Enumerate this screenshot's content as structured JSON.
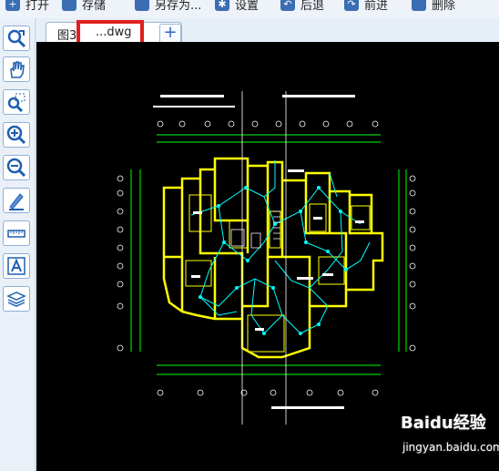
{
  "toolbar": {
    "open": "打开",
    "save": "存储",
    "save_as": "另存为...",
    "settings": "设置",
    "back": "后退",
    "forward": "前进",
    "delete": "删除"
  },
  "tabs": {
    "file_prefix": "图3",
    "file_suffix": "...dwg",
    "add": "+"
  },
  "watermark": {
    "brand": "Baidu经验",
    "url": "jingyan.baidu.com"
  },
  "colors": {
    "canvas_bg": "#000000",
    "walls": "#ffff00",
    "wiring": "#00ffff",
    "dims": "#00ff00",
    "annotation": "#ffffff",
    "highlight": "#e02020"
  }
}
